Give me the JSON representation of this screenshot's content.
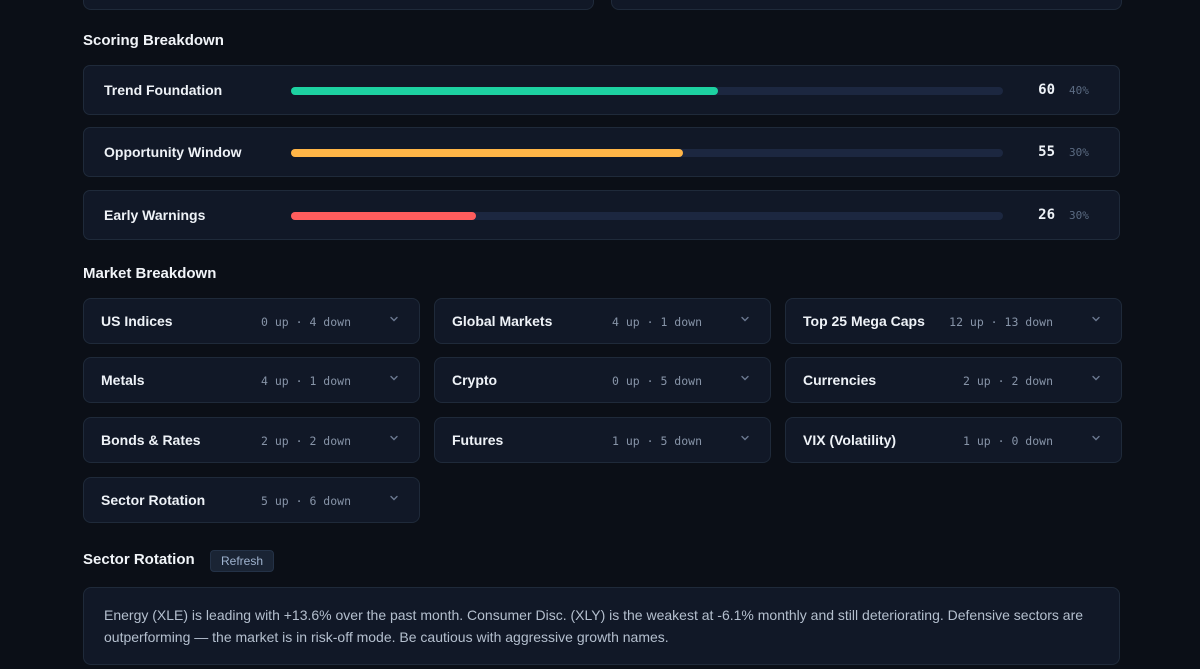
{
  "colors": {
    "background": "#0b0f17",
    "card": "#111827",
    "trend": "#1dd1a1",
    "opportunity": "#ffb547",
    "warning": "#ff5d5d",
    "track": "#1c2740"
  },
  "scoring": {
    "title": "Scoring Breakdown",
    "rows": [
      {
        "label": "Trend Foundation",
        "score": "60",
        "weight": "40%",
        "fill_pct": 60,
        "color": "#1dd1a1"
      },
      {
        "label": "Opportunity Window",
        "score": "55",
        "weight": "30%",
        "fill_pct": 55,
        "color": "#ffb547"
      },
      {
        "label": "Early Warnings",
        "score": "26",
        "weight": "30%",
        "fill_pct": 26,
        "color": "#ff5d5d"
      }
    ]
  },
  "market": {
    "title": "Market Breakdown",
    "cards": [
      {
        "name": "US Indices",
        "counts": "0 up · 4 down",
        "icon": "chevron-down-icon"
      },
      {
        "name": "Global Markets",
        "counts": "4 up · 1 down",
        "icon": "chevron-down-icon"
      },
      {
        "name": "Top 25 Mega Caps",
        "counts": "12 up · 13 down",
        "icon": "chevron-down-icon"
      },
      {
        "name": "Metals",
        "counts": "4 up · 1 down",
        "icon": "chevron-down-icon"
      },
      {
        "name": "Crypto",
        "counts": "0 up · 5 down",
        "icon": "chevron-down-icon"
      },
      {
        "name": "Currencies",
        "counts": "2 up · 2 down",
        "icon": "chevron-down-icon"
      },
      {
        "name": "Bonds & Rates",
        "counts": "2 up · 2 down",
        "icon": "chevron-down-icon"
      },
      {
        "name": "Futures",
        "counts": "1 up · 5 down",
        "icon": "chevron-down-icon"
      },
      {
        "name": "VIX (Volatility)",
        "counts": "1 up · 0 down",
        "icon": "chevron-down-icon"
      },
      {
        "name": "Sector Rotation",
        "counts": "5 up · 6 down",
        "icon": "chevron-down-icon"
      }
    ]
  },
  "sector_rotation": {
    "title": "Sector Rotation",
    "refresh_label": "Refresh",
    "summary": "Energy (XLE) is leading with +13.6% over the past month. Consumer Disc. (XLY) is the weakest at -6.1% monthly and still deteriorating. Defensive sectors are outperforming — the market is in risk-off mode. Be cautious with aggressive growth names."
  }
}
